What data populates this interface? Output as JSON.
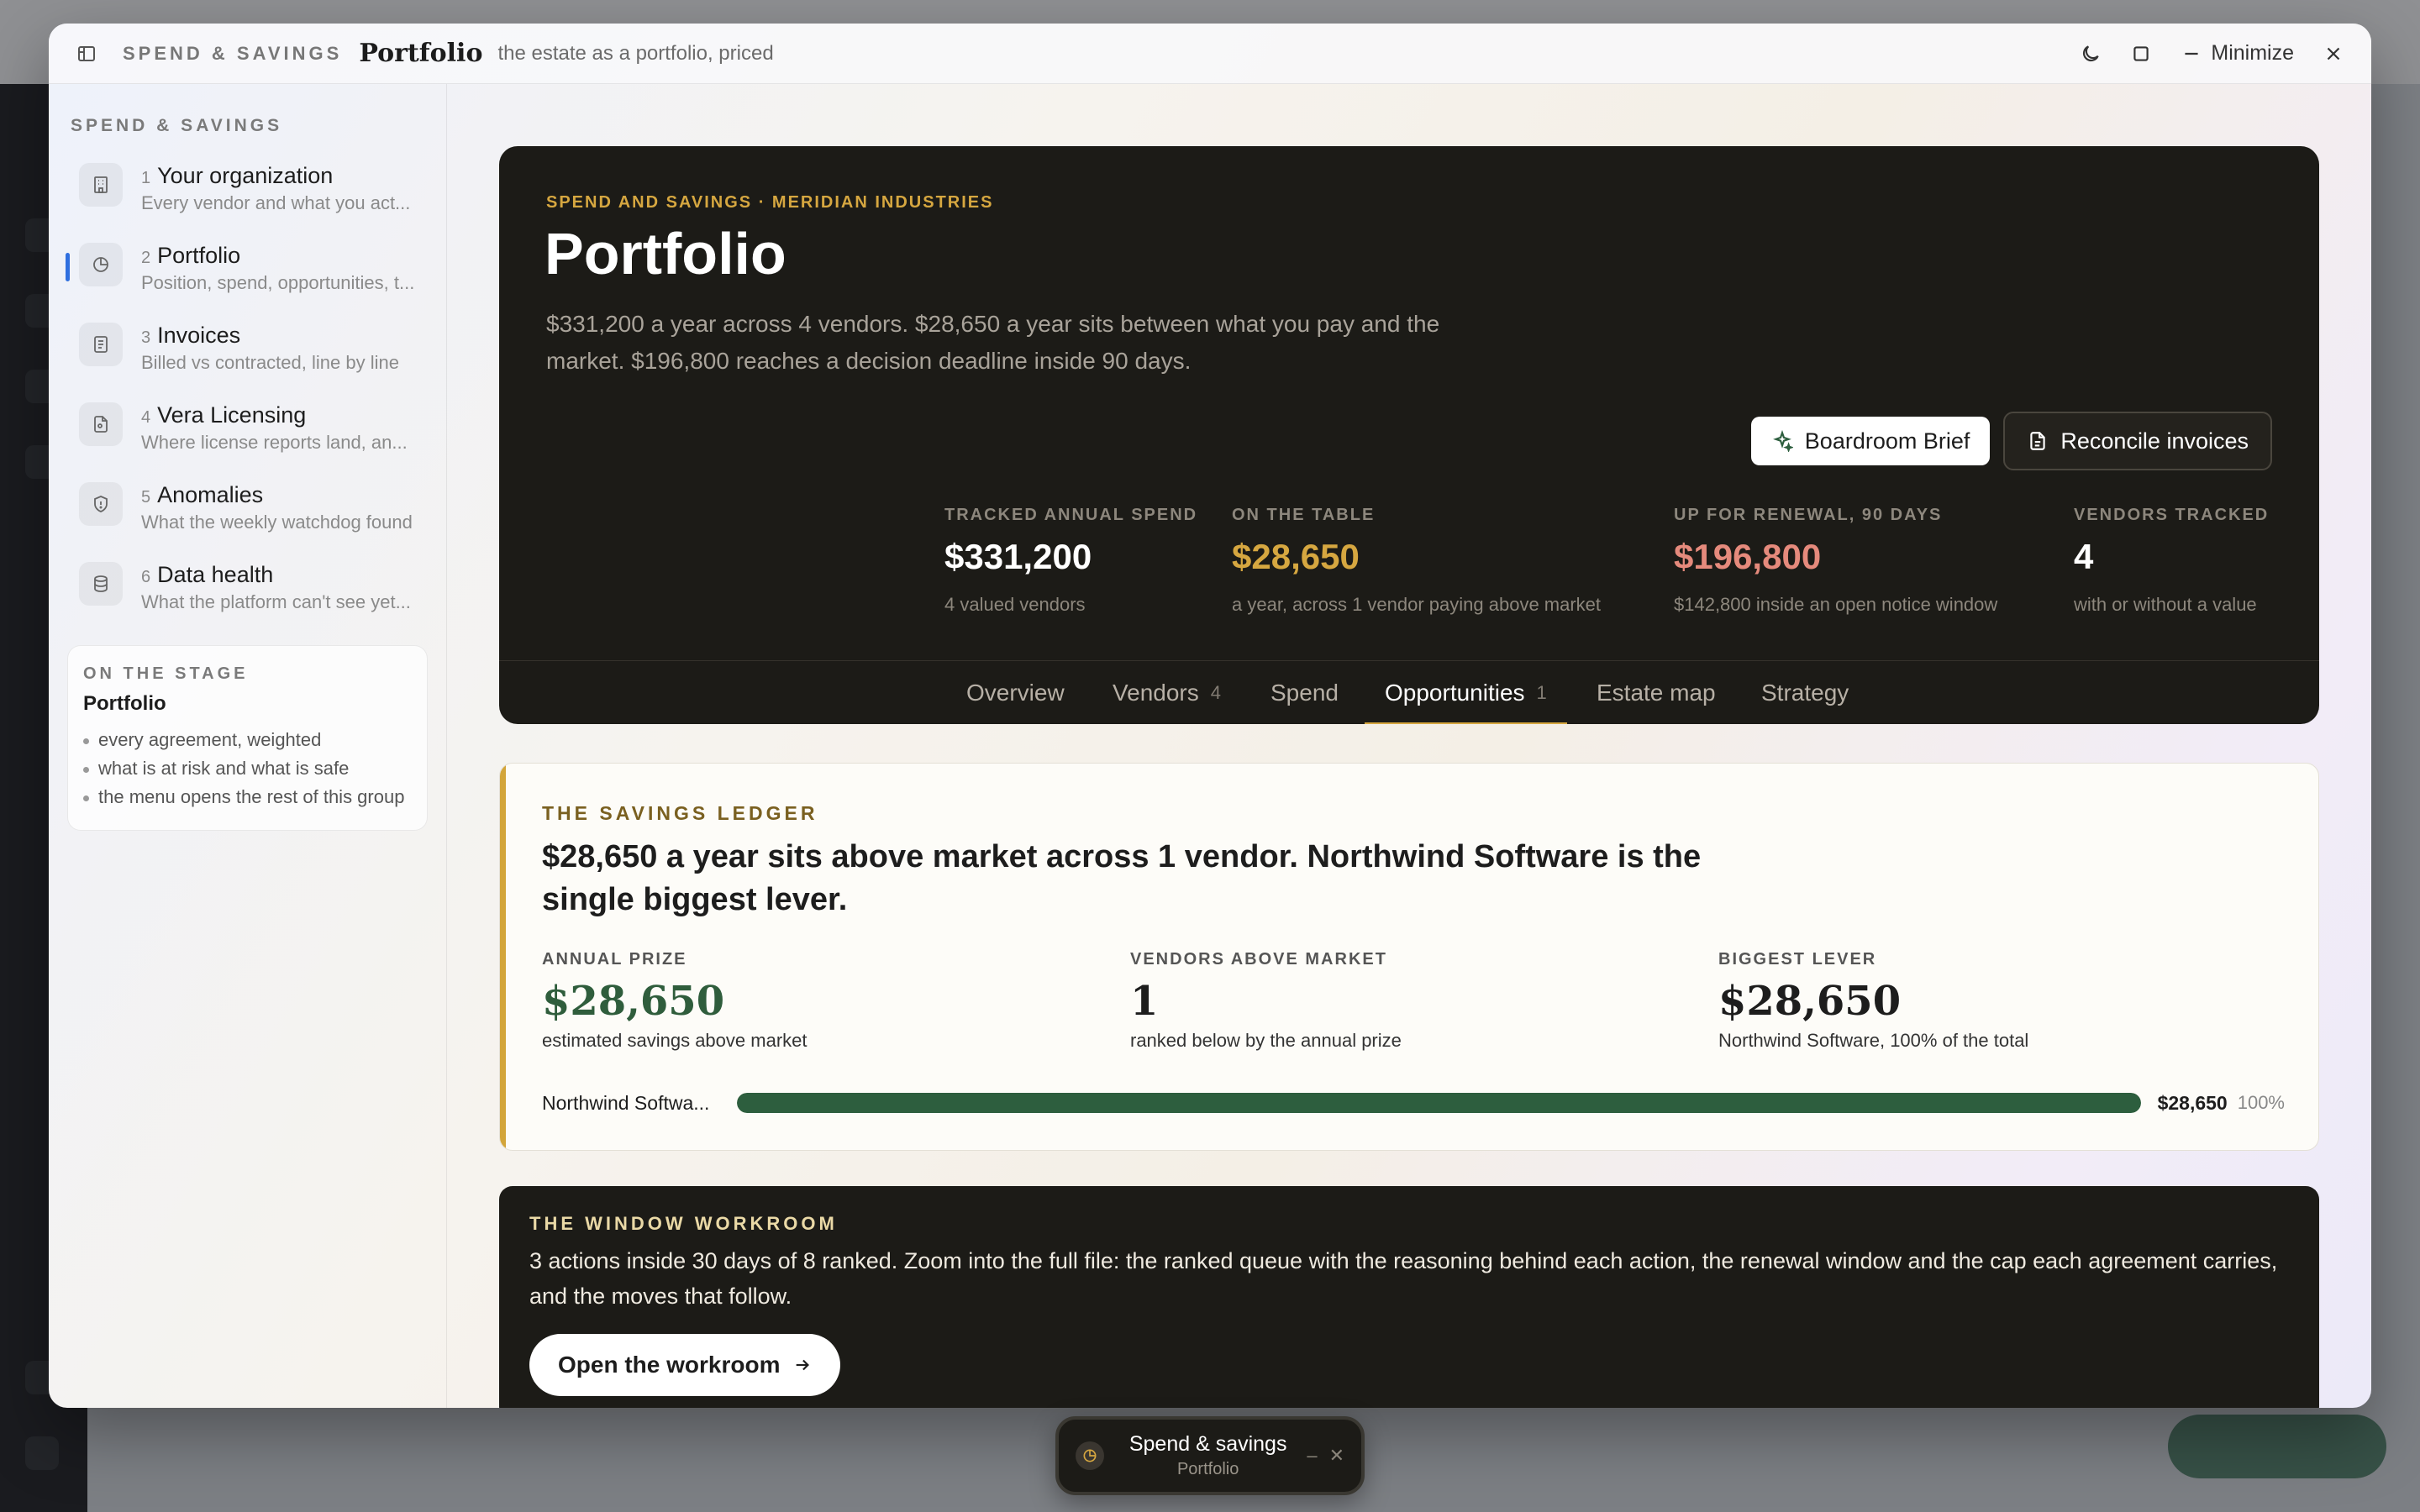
{
  "window": {
    "section": "SPEND & SAVINGS",
    "title": "Portfolio",
    "subtitle": "the estate as a portfolio, priced",
    "minimize_label": "Minimize"
  },
  "sidebar": {
    "heading": "SPEND & SAVINGS",
    "items": [
      {
        "num": "1",
        "label": "Your organization",
        "desc": "Every vendor and what you act...",
        "icon": "building-icon"
      },
      {
        "num": "2",
        "label": "Portfolio",
        "desc": "Position, spend, opportunities, t...",
        "icon": "pie-chart-icon",
        "active": true
      },
      {
        "num": "3",
        "label": "Invoices",
        "desc": "Billed vs contracted, line by line",
        "icon": "document-icon"
      },
      {
        "num": "4",
        "label": "Vera Licensing",
        "desc": "Where license reports land, an...",
        "icon": "license-file-icon"
      },
      {
        "num": "5",
        "label": "Anomalies",
        "desc": "What the weekly watchdog found",
        "icon": "shield-icon"
      },
      {
        "num": "6",
        "label": "Data health",
        "desc": "What the platform can't see yet...",
        "icon": "database-icon"
      }
    ],
    "stage": {
      "kicker": "ON THE STAGE",
      "title": "Portfolio",
      "points": [
        "every agreement, weighted",
        "what is at risk and what is safe",
        "the menu opens the rest of this group"
      ]
    }
  },
  "hero": {
    "kicker": "SPEND AND SAVINGS · MERIDIAN INDUSTRIES",
    "title": "Portfolio",
    "subtitle": "$331,200 a year across 4 vendors. $28,650 a year sits between what you pay and the market. $196,800 reaches a decision deadline inside 90 days.",
    "actions": {
      "brief": "Boardroom Brief",
      "reconcile": "Reconcile invoices"
    },
    "stats": [
      {
        "key": "TRACKED ANNUAL SPEND",
        "value": "$331,200",
        "note": "4 valued vendors",
        "color": "#ffffff"
      },
      {
        "key": "ON THE TABLE",
        "value": "$28,650",
        "note": "a year, across 1 vendor paying above market",
        "color": "#d6a740"
      },
      {
        "key": "UP FOR RENEWAL, 90 DAYS",
        "value": "$196,800",
        "note": "$142,800 inside an open notice window",
        "color": "#e58a7c"
      },
      {
        "key": "VENDORS TRACKED",
        "value": "4",
        "note": "with or without a value",
        "color": "#ffffff"
      }
    ],
    "tabs": [
      {
        "label": "Overview",
        "count": ""
      },
      {
        "label": "Vendors",
        "count": "4"
      },
      {
        "label": "Spend",
        "count": ""
      },
      {
        "label": "Opportunities",
        "count": "1",
        "active": true
      },
      {
        "label": "Estate map",
        "count": ""
      },
      {
        "label": "Strategy",
        "count": ""
      }
    ]
  },
  "ledger": {
    "kicker": "THE SAVINGS LEDGER",
    "headline": "$28,650 a year sits above market across 1 vendor. Northwind Software is the single biggest lever.",
    "stats": [
      {
        "key": "ANNUAL PRIZE",
        "value": "$28,650",
        "note": "estimated savings above market"
      },
      {
        "key": "VENDORS ABOVE MARKET",
        "value": "1",
        "note": "ranked below by the annual prize"
      },
      {
        "key": "BIGGEST LEVER",
        "value": "$28,650",
        "note": "Northwind Software, 100% of the total"
      }
    ],
    "bar": {
      "label": "Northwind Softwa...",
      "value": "$28,650",
      "pct": "100%",
      "fill_fraction": 1.0
    }
  },
  "workroom": {
    "kicker": "THE WINDOW WORKROOM",
    "text": "3 actions inside 30 days of 8 ranked. Zoom into the full file: the ranked queue with the reasoning behind each action, the renewal window and the cap each agreement carries, and the moves that follow.",
    "button": "Open the workroom"
  },
  "dock": {
    "title": "Spend & savings",
    "subtitle": "Portfolio"
  }
}
